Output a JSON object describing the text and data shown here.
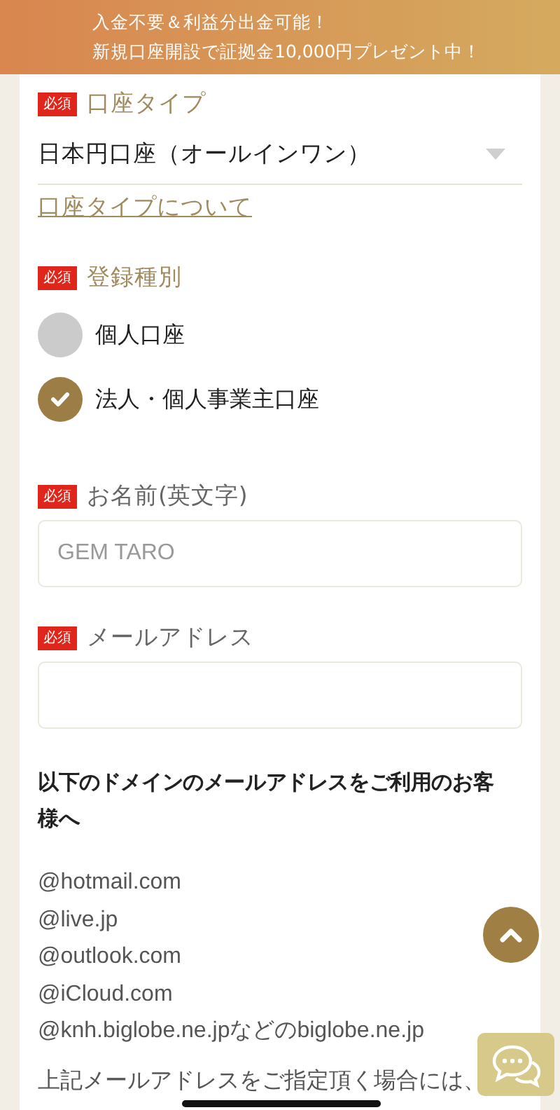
{
  "banner": {
    "lines": [
      "入金不要＆利益分出金可能！",
      "新規口座開設で証拠金10,000円プレゼント中！"
    ]
  },
  "fields": [
    {
      "kind": "select",
      "badge": "必須",
      "label": "口座タイプ",
      "value": "日本円口座（オールインワン）",
      "link": "口座タイプについて"
    },
    {
      "kind": "radio",
      "badge": "必須",
      "label": "登録種別",
      "options": [
        {
          "label": "個人口座",
          "selected": false
        },
        {
          "label": "法人・個人事業主口座",
          "selected": true
        }
      ]
    },
    {
      "kind": "input",
      "badge": "必須",
      "label": "お名前(英文字)",
      "placeholder": "GEM TARO"
    },
    {
      "kind": "input",
      "badge": "必須",
      "label": "メールアドレス"
    }
  ],
  "notice": {
    "heading": "以下のドメインのメールアドレスをご利用のお客様へ",
    "domains": [
      "@hotmail.com",
      "@live.jp",
      "@outlook.com",
      "@iCloud.com",
      "@knh.biglobe.ne.jpなどのbiglobe.ne.jp"
    ],
    "text": "上記メールアドレスをご指定頂く場合には、"
  }
}
